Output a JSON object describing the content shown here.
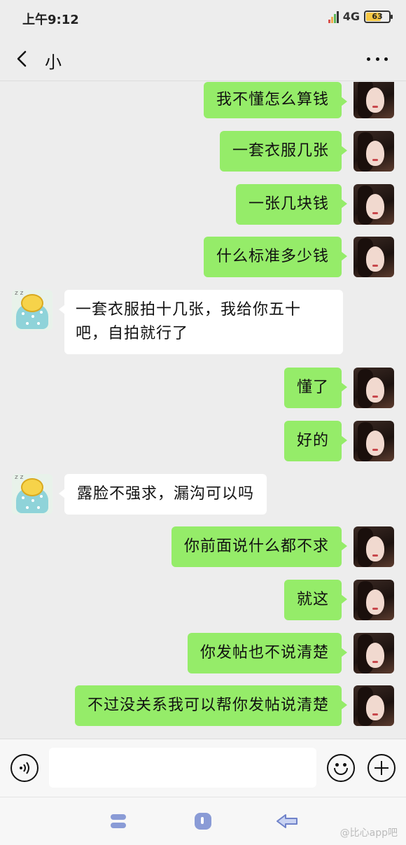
{
  "status_bar": {
    "time": "上午9:12",
    "network": "4G",
    "battery": "63"
  },
  "header": {
    "title": "小"
  },
  "messages": [
    {
      "from": "me",
      "text": "我不懂怎么算钱"
    },
    {
      "from": "me",
      "text": "一套衣服几张"
    },
    {
      "from": "me",
      "text": "一张几块钱"
    },
    {
      "from": "me",
      "text": "什么标准多少钱"
    },
    {
      "from": "other",
      "text": "一套衣服拍十几张，我给你五十吧，自拍就行了"
    },
    {
      "from": "me",
      "text": "懂了"
    },
    {
      "from": "me",
      "text": "好的"
    },
    {
      "from": "other",
      "text": "露脸不强求，漏沟可以吗"
    },
    {
      "from": "me",
      "text": "你前面说什么都不求"
    },
    {
      "from": "me",
      "text": "就这"
    },
    {
      "from": "me",
      "text": "你发帖也不说清楚"
    },
    {
      "from": "me",
      "text": "不过没关系我可以帮你发帖说清楚"
    }
  ],
  "input_bar": {
    "value": ""
  },
  "watermark": "@比心app吧"
}
